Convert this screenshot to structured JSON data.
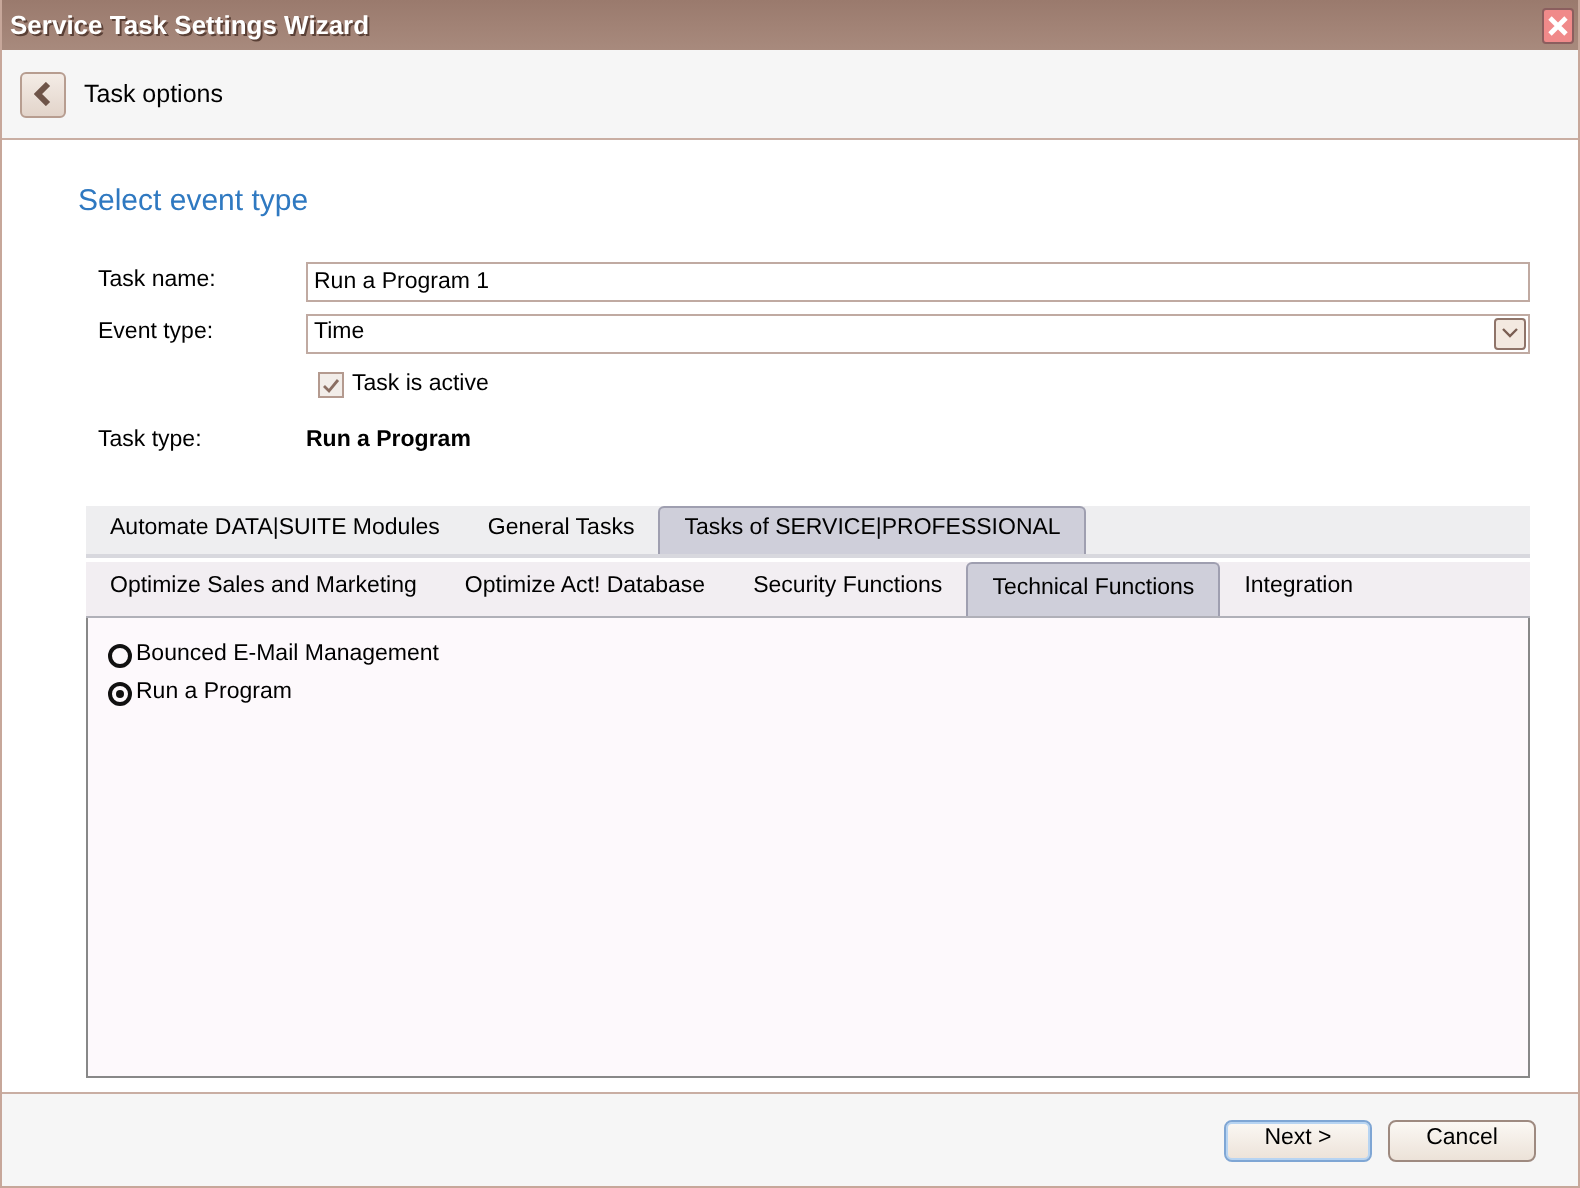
{
  "window": {
    "title": "Service Task Settings Wizard"
  },
  "header": {
    "title": "Task options"
  },
  "section_title": "Select event type",
  "form": {
    "task_name": {
      "label": "Task name:",
      "value": "Run a Program 1"
    },
    "event_type": {
      "label": "Event type:",
      "value": "Time"
    },
    "active": {
      "label": "Task is active",
      "checked": true
    },
    "task_type": {
      "label": "Task type:",
      "value": "Run a Program"
    }
  },
  "tabs": [
    {
      "label": "Automate DATA|SUITE Modules",
      "selected": false
    },
    {
      "label": "General Tasks",
      "selected": false
    },
    {
      "label": "Tasks of SERVICE|PROFESSIONAL",
      "selected": true
    }
  ],
  "subtabs": [
    {
      "label": "Optimize Sales and Marketing",
      "selected": false
    },
    {
      "label": "Optimize Act! Database",
      "selected": false
    },
    {
      "label": "Security Functions",
      "selected": false
    },
    {
      "label": "Technical Functions",
      "selected": true
    },
    {
      "label": "Integration",
      "selected": false
    }
  ],
  "options": [
    {
      "label": "Bounced E-Mail Management",
      "selected": false
    },
    {
      "label": "Run a Program",
      "selected": true
    }
  ],
  "buttons": [
    {
      "label": "Next >",
      "kind": "default"
    },
    {
      "label": "Cancel",
      "kind": "normal"
    }
  ]
}
